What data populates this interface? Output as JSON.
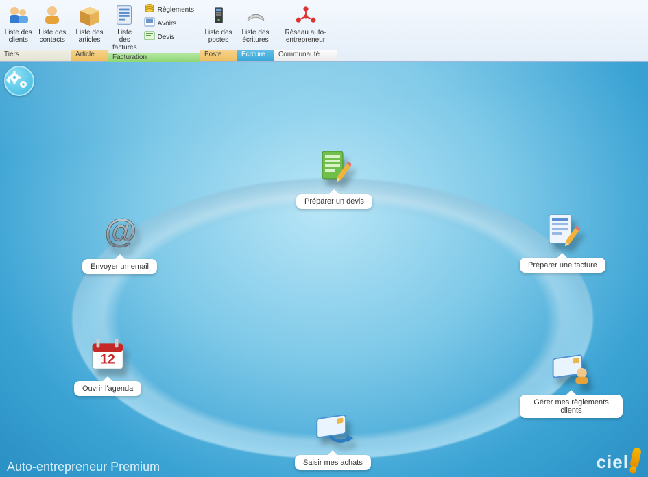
{
  "ribbon": {
    "tiers": {
      "group_label": "Tiers",
      "clients": "Liste des clients",
      "contacts": "Liste des contacts"
    },
    "article": {
      "group_label": "Article",
      "articles": "Liste des articles"
    },
    "facturation": {
      "group_label": "Facturation",
      "factures": "Liste des factures",
      "reglements": "Règlements",
      "avoirs": "Avoirs",
      "devis": "Devis"
    },
    "poste": {
      "group_label": "Poste",
      "postes": "Liste des postes"
    },
    "ecriture": {
      "group_label": "Ecriture",
      "ecritures": "Liste des écritures"
    },
    "communaute": {
      "group_label": "Communauté",
      "reseau": "Réseau auto-entrepreneur"
    }
  },
  "nodes": {
    "devis": "Préparer un devis",
    "facture": "Préparer une facture",
    "reglements": "Gérer mes règlements clients",
    "achats": "Saisir mes achats",
    "agenda": "Ouvrir l'agenda",
    "email": "Envoyer un email"
  },
  "calendar_day": "12",
  "footer": {
    "title": "Auto-entrepreneur Premium",
    "brand": "ciel"
  }
}
